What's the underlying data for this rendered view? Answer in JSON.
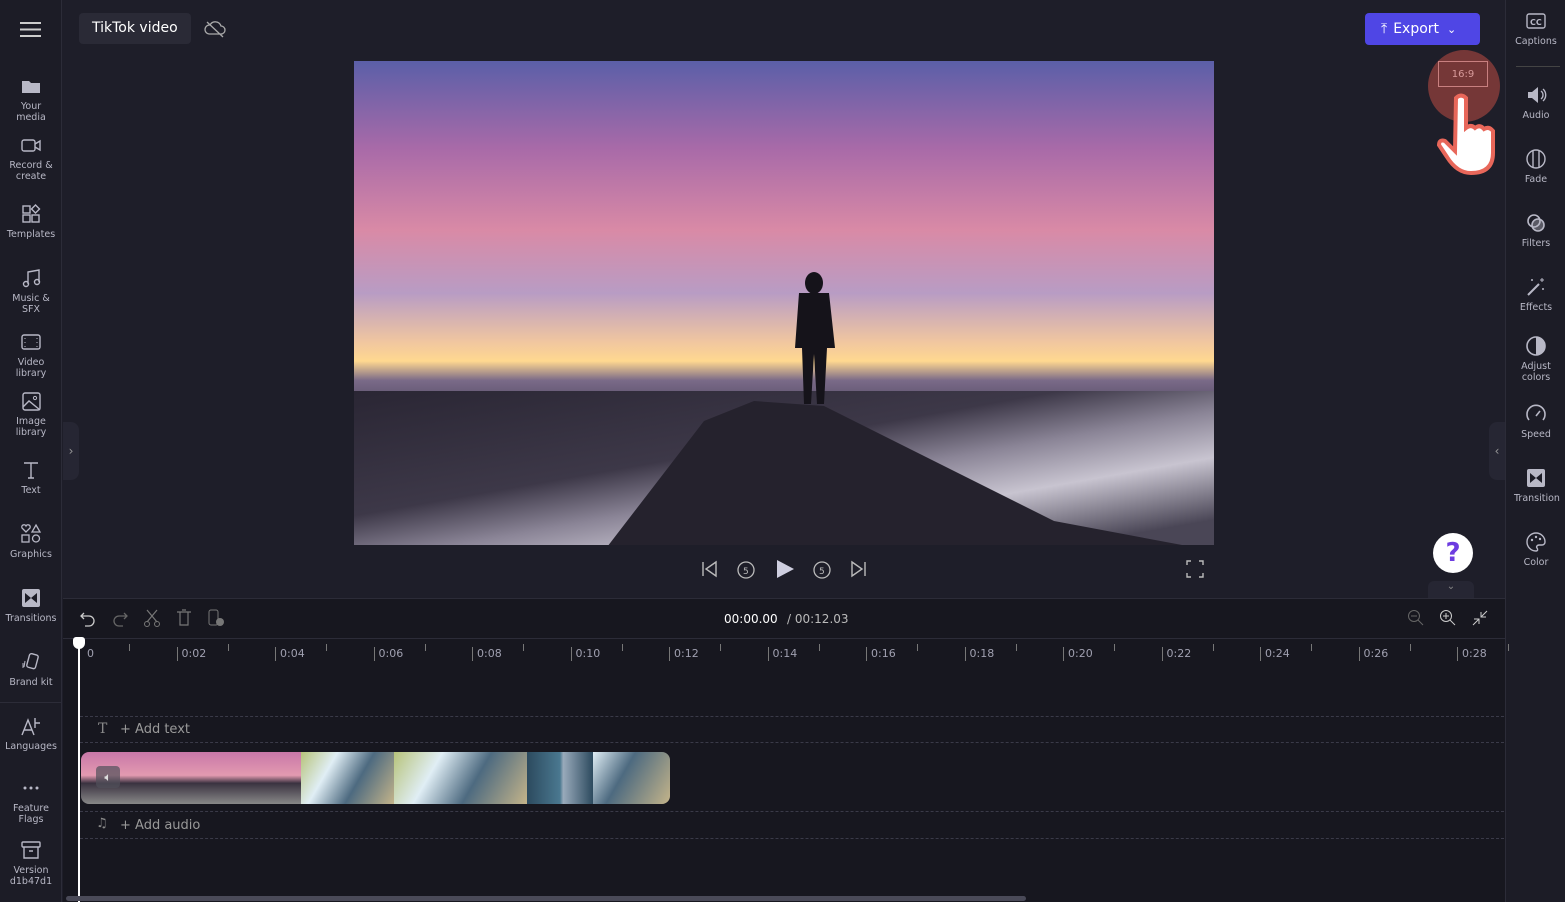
{
  "header": {
    "menu_icon": "hamburger-icon",
    "project_title": "TikTok video",
    "cloud_icon": "cloud-off-icon",
    "export_label": "Export"
  },
  "left_sidebar": {
    "items": [
      {
        "label": "Your media",
        "icon": "folder-icon"
      },
      {
        "label": "Record & create",
        "icon": "camera-icon"
      },
      {
        "label": "Templates",
        "icon": "templates-icon"
      },
      {
        "label": "Music & SFX",
        "icon": "music-icon"
      },
      {
        "label": "Video library",
        "icon": "film-icon"
      },
      {
        "label": "Image library",
        "icon": "image-icon"
      },
      {
        "label": "Text",
        "icon": "text-icon"
      },
      {
        "label": "Graphics",
        "icon": "shapes-icon"
      },
      {
        "label": "Transitions",
        "icon": "transition-icon"
      },
      {
        "label": "Brand kit",
        "icon": "brand-icon"
      },
      {
        "label": "Languages",
        "icon": "language-icon"
      },
      {
        "label": "Feature Flags",
        "icon": "more-icon"
      },
      {
        "label": "Version d1b47d1",
        "icon": "archive-icon"
      }
    ]
  },
  "right_sidebar": {
    "items": [
      {
        "label": "Captions",
        "icon": "cc-icon"
      },
      {
        "label": "Audio",
        "icon": "speaker-icon"
      },
      {
        "label": "Fade",
        "icon": "fade-icon"
      },
      {
        "label": "Filters",
        "icon": "filters-icon"
      },
      {
        "label": "Effects",
        "icon": "wand-icon"
      },
      {
        "label": "Adjust colors",
        "icon": "contrast-icon"
      },
      {
        "label": "Speed",
        "icon": "speedometer-icon"
      },
      {
        "label": "Transition",
        "icon": "transition-icon"
      },
      {
        "label": "Color",
        "icon": "palette-icon"
      }
    ]
  },
  "aspect_ratio": "16:9",
  "player": {
    "current_time": "00:00.00",
    "total_time": "/ 00:12.03"
  },
  "timeline": {
    "ruler": [
      "0",
      "0:02",
      "0:04",
      "0:06",
      "0:08",
      "0:10",
      "0:12",
      "0:14",
      "0:16",
      "0:18",
      "0:20",
      "0:22",
      "0:24",
      "0:26",
      "0:28"
    ],
    "add_text": "+ Add text",
    "add_audio": "+ Add audio"
  },
  "help": "?",
  "colors": {
    "accent": "#4f46e5",
    "cursor_highlight": "#e0574a"
  }
}
